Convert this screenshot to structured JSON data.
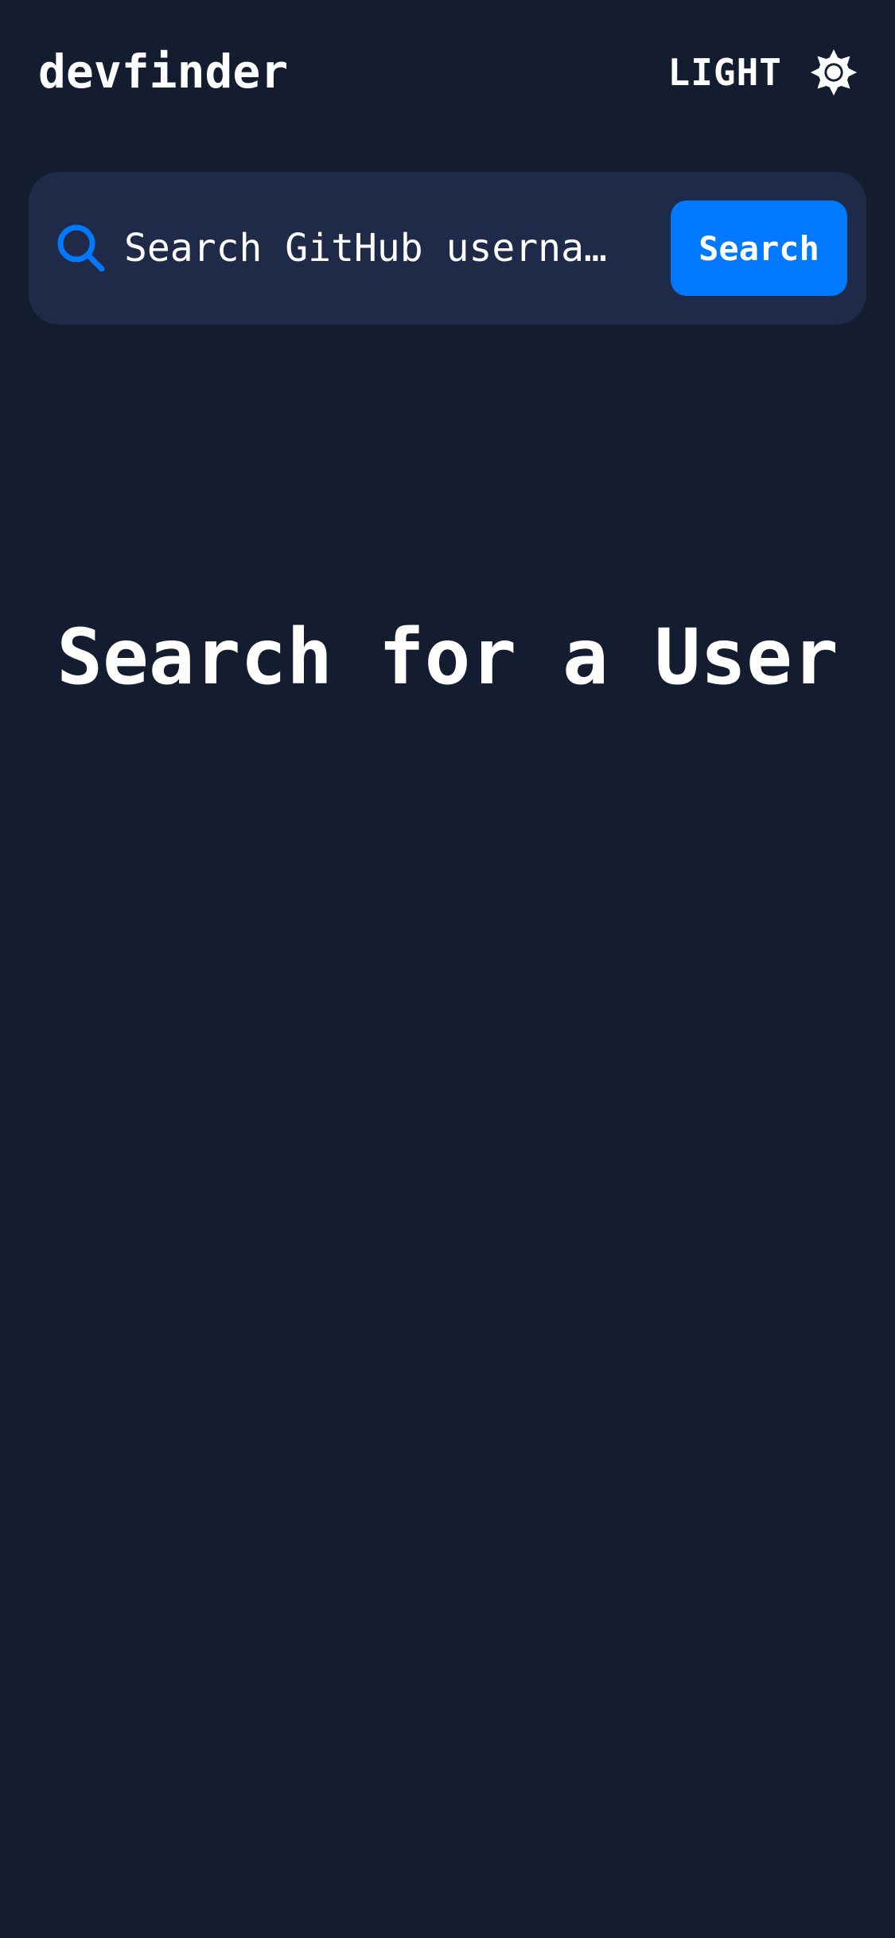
{
  "header": {
    "logo": "devfinder",
    "theme_toggle_label": "LIGHT",
    "theme_icon": "sun-icon"
  },
  "search": {
    "placeholder": "Search GitHub userna…",
    "value": "",
    "button_label": "Search",
    "icon": "search-icon",
    "accent_color": "#0079ff",
    "bar_color": "#1f2a48"
  },
  "main": {
    "empty_message": "Search for a User"
  },
  "colors": {
    "background": "#141c2f",
    "text": "#ffffff"
  }
}
